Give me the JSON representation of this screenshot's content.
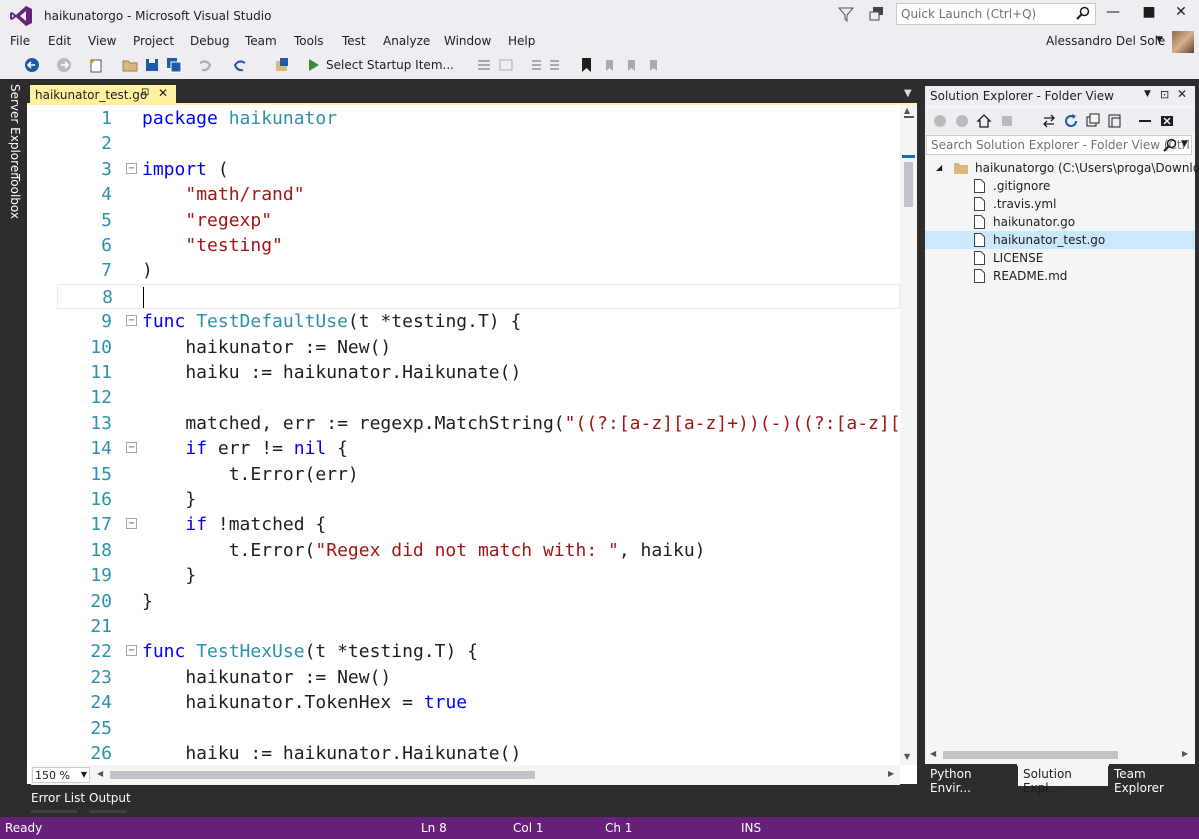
{
  "window": {
    "title": "haikunatorgo - Microsoft Visual Studio",
    "quick_launch_placeholder": "Quick Launch (Ctrl+Q)"
  },
  "menu": [
    "File",
    "Edit",
    "View",
    "Project",
    "Debug",
    "Team",
    "Tools",
    "Test",
    "Analyze",
    "Window",
    "Help"
  ],
  "user": {
    "name": "Alessandro Del Sole"
  },
  "toolbar": {
    "startup_label": "Select Startup Item..."
  },
  "left_strip": {
    "server_explorer": "Server Explorer",
    "toolbox": "Toolbox"
  },
  "document_tab": {
    "name": "haikunator_test.go"
  },
  "editor": {
    "zoom": "150 %",
    "lines": [
      {
        "n": "1",
        "text": "package haikunator"
      },
      {
        "n": "2",
        "text": ""
      },
      {
        "n": "3",
        "text": "import ("
      },
      {
        "n": "4",
        "text": "    \"math/rand\""
      },
      {
        "n": "5",
        "text": "    \"regexp\""
      },
      {
        "n": "6",
        "text": "    \"testing\""
      },
      {
        "n": "7",
        "text": ")"
      },
      {
        "n": "8",
        "text": ""
      },
      {
        "n": "9",
        "text": "func TestDefaultUse(t *testing.T) {"
      },
      {
        "n": "10",
        "text": "    haikunator := New()"
      },
      {
        "n": "11",
        "text": "    haiku := haikunator.Haikunate()"
      },
      {
        "n": "12",
        "text": ""
      },
      {
        "n": "13",
        "text": "    matched, err := regexp.MatchString(\"((?:[a-z][a-z]+))(-)((?:[a-z][a"
      },
      {
        "n": "14",
        "text": "    if err != nil {"
      },
      {
        "n": "15",
        "text": "        t.Error(err)"
      },
      {
        "n": "16",
        "text": "    }"
      },
      {
        "n": "17",
        "text": "    if !matched {"
      },
      {
        "n": "18",
        "text": "        t.Error(\"Regex did not match with: \", haiku)"
      },
      {
        "n": "19",
        "text": "    }"
      },
      {
        "n": "20",
        "text": "}"
      },
      {
        "n": "21",
        "text": ""
      },
      {
        "n": "22",
        "text": "func TestHexUse(t *testing.T) {"
      },
      {
        "n": "23",
        "text": "    haikunator := New()"
      },
      {
        "n": "24",
        "text": "    haikunator.TokenHex = true"
      },
      {
        "n": "25",
        "text": ""
      },
      {
        "n": "26",
        "text": "    haiku := haikunator.Haikunate()"
      }
    ]
  },
  "solution_explorer": {
    "title": "Solution Explorer - Folder View",
    "search_placeholder": "Search Solution Explorer - Folder View (Ctrl",
    "root": "haikunatorgo (C:\\Users\\proga\\Download",
    "files": [
      ".gitignore",
      ".travis.yml",
      "haikunator.go",
      "haikunator_test.go",
      "LICENSE",
      "README.md"
    ],
    "selected": "haikunator_test.go",
    "tabs": [
      "Python Envir...",
      "Solution Expl...",
      "Team Explorer"
    ]
  },
  "bottom_tabs": [
    "Error List",
    "Output"
  ],
  "status": {
    "state": "Ready",
    "ln": "Ln 8",
    "col": "Col 1",
    "ch": "Ch 1",
    "mode": "INS"
  }
}
